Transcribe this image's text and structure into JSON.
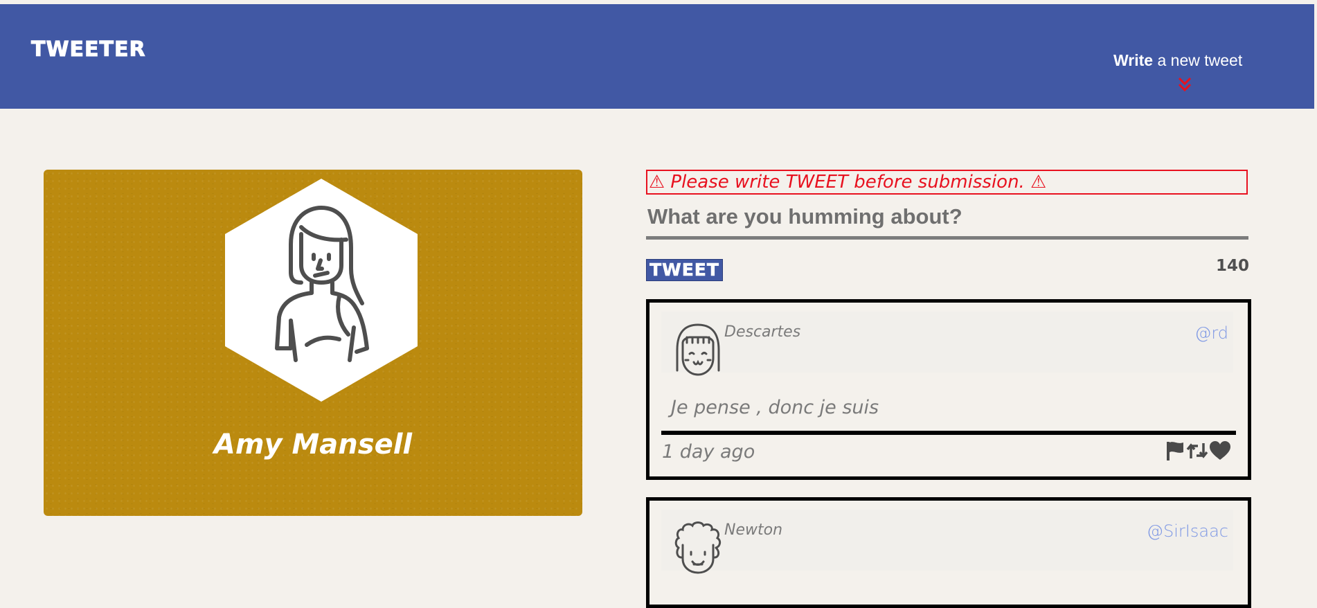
{
  "header": {
    "brand": "TWEETER",
    "compose_bold": "Write",
    "compose_rest": " a new tweet",
    "compose_arrow_icon": "double-chevron-down-icon",
    "background_color": "#4158a4",
    "arrow_color": "#e8111f"
  },
  "profile": {
    "name": "Amy Mansell",
    "avatar_icon": "woman-avatar-icon",
    "card_color": "#bb8a0f"
  },
  "composer": {
    "error_message": "⚠ Please write TWEET before submission. ⚠",
    "placeholder": "What are you humming about?",
    "value": "",
    "submit_label": "TWEET",
    "char_counter": "140",
    "error_color": "#e8111f"
  },
  "tweets": [
    {
      "name": "Descartes",
      "handle": "@rd",
      "text": "Je pense , donc je suis",
      "time": "1 day ago",
      "avatar_icon": "girl-avatar-icon",
      "actions": [
        "flag-icon",
        "retweet-icon",
        "heart-icon"
      ]
    },
    {
      "name": "Newton",
      "handle": "@SirIsaac",
      "avatar_icon": "curly-hair-avatar-icon"
    }
  ]
}
